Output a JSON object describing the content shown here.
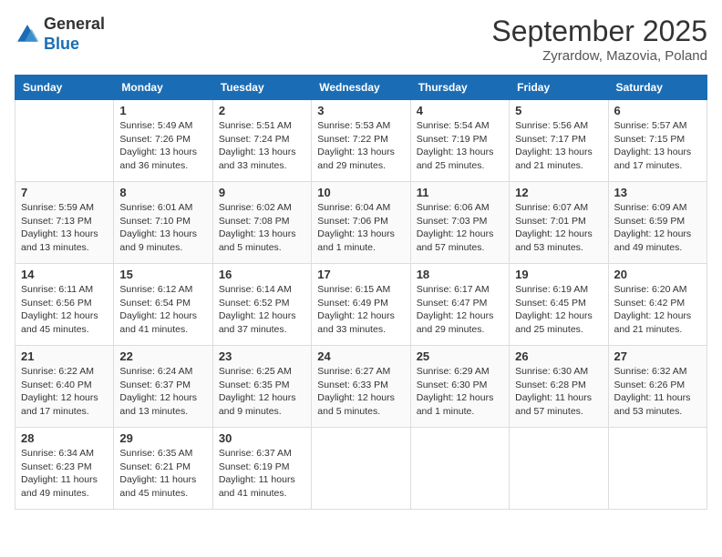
{
  "header": {
    "logo_general": "General",
    "logo_blue": "Blue",
    "month_title": "September 2025",
    "location": "Zyrardow, Mazovia, Poland"
  },
  "days_of_week": [
    "Sunday",
    "Monday",
    "Tuesday",
    "Wednesday",
    "Thursday",
    "Friday",
    "Saturday"
  ],
  "weeks": [
    [
      {
        "day": "",
        "info": ""
      },
      {
        "day": "1",
        "info": "Sunrise: 5:49 AM\nSunset: 7:26 PM\nDaylight: 13 hours and 36 minutes."
      },
      {
        "day": "2",
        "info": "Sunrise: 5:51 AM\nSunset: 7:24 PM\nDaylight: 13 hours and 33 minutes."
      },
      {
        "day": "3",
        "info": "Sunrise: 5:53 AM\nSunset: 7:22 PM\nDaylight: 13 hours and 29 minutes."
      },
      {
        "day": "4",
        "info": "Sunrise: 5:54 AM\nSunset: 7:19 PM\nDaylight: 13 hours and 25 minutes."
      },
      {
        "day": "5",
        "info": "Sunrise: 5:56 AM\nSunset: 7:17 PM\nDaylight: 13 hours and 21 minutes."
      },
      {
        "day": "6",
        "info": "Sunrise: 5:57 AM\nSunset: 7:15 PM\nDaylight: 13 hours and 17 minutes."
      }
    ],
    [
      {
        "day": "7",
        "info": "Sunrise: 5:59 AM\nSunset: 7:13 PM\nDaylight: 13 hours and 13 minutes."
      },
      {
        "day": "8",
        "info": "Sunrise: 6:01 AM\nSunset: 7:10 PM\nDaylight: 13 hours and 9 minutes."
      },
      {
        "day": "9",
        "info": "Sunrise: 6:02 AM\nSunset: 7:08 PM\nDaylight: 13 hours and 5 minutes."
      },
      {
        "day": "10",
        "info": "Sunrise: 6:04 AM\nSunset: 7:06 PM\nDaylight: 13 hours and 1 minute."
      },
      {
        "day": "11",
        "info": "Sunrise: 6:06 AM\nSunset: 7:03 PM\nDaylight: 12 hours and 57 minutes."
      },
      {
        "day": "12",
        "info": "Sunrise: 6:07 AM\nSunset: 7:01 PM\nDaylight: 12 hours and 53 minutes."
      },
      {
        "day": "13",
        "info": "Sunrise: 6:09 AM\nSunset: 6:59 PM\nDaylight: 12 hours and 49 minutes."
      }
    ],
    [
      {
        "day": "14",
        "info": "Sunrise: 6:11 AM\nSunset: 6:56 PM\nDaylight: 12 hours and 45 minutes."
      },
      {
        "day": "15",
        "info": "Sunrise: 6:12 AM\nSunset: 6:54 PM\nDaylight: 12 hours and 41 minutes."
      },
      {
        "day": "16",
        "info": "Sunrise: 6:14 AM\nSunset: 6:52 PM\nDaylight: 12 hours and 37 minutes."
      },
      {
        "day": "17",
        "info": "Sunrise: 6:15 AM\nSunset: 6:49 PM\nDaylight: 12 hours and 33 minutes."
      },
      {
        "day": "18",
        "info": "Sunrise: 6:17 AM\nSunset: 6:47 PM\nDaylight: 12 hours and 29 minutes."
      },
      {
        "day": "19",
        "info": "Sunrise: 6:19 AM\nSunset: 6:45 PM\nDaylight: 12 hours and 25 minutes."
      },
      {
        "day": "20",
        "info": "Sunrise: 6:20 AM\nSunset: 6:42 PM\nDaylight: 12 hours and 21 minutes."
      }
    ],
    [
      {
        "day": "21",
        "info": "Sunrise: 6:22 AM\nSunset: 6:40 PM\nDaylight: 12 hours and 17 minutes."
      },
      {
        "day": "22",
        "info": "Sunrise: 6:24 AM\nSunset: 6:37 PM\nDaylight: 12 hours and 13 minutes."
      },
      {
        "day": "23",
        "info": "Sunrise: 6:25 AM\nSunset: 6:35 PM\nDaylight: 12 hours and 9 minutes."
      },
      {
        "day": "24",
        "info": "Sunrise: 6:27 AM\nSunset: 6:33 PM\nDaylight: 12 hours and 5 minutes."
      },
      {
        "day": "25",
        "info": "Sunrise: 6:29 AM\nSunset: 6:30 PM\nDaylight: 12 hours and 1 minute."
      },
      {
        "day": "26",
        "info": "Sunrise: 6:30 AM\nSunset: 6:28 PM\nDaylight: 11 hours and 57 minutes."
      },
      {
        "day": "27",
        "info": "Sunrise: 6:32 AM\nSunset: 6:26 PM\nDaylight: 11 hours and 53 minutes."
      }
    ],
    [
      {
        "day": "28",
        "info": "Sunrise: 6:34 AM\nSunset: 6:23 PM\nDaylight: 11 hours and 49 minutes."
      },
      {
        "day": "29",
        "info": "Sunrise: 6:35 AM\nSunset: 6:21 PM\nDaylight: 11 hours and 45 minutes."
      },
      {
        "day": "30",
        "info": "Sunrise: 6:37 AM\nSunset: 6:19 PM\nDaylight: 11 hours and 41 minutes."
      },
      {
        "day": "",
        "info": ""
      },
      {
        "day": "",
        "info": ""
      },
      {
        "day": "",
        "info": ""
      },
      {
        "day": "",
        "info": ""
      }
    ]
  ]
}
